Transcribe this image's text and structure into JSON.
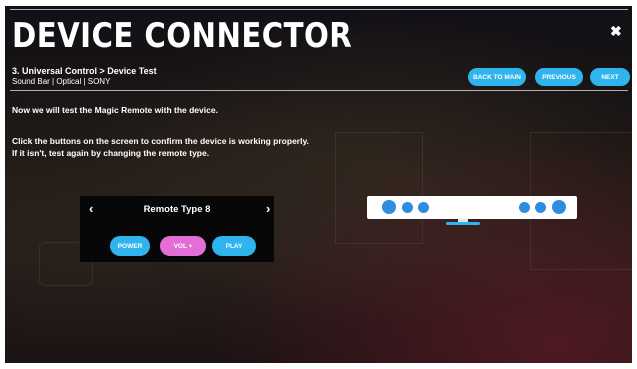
{
  "header": {
    "title": "DEVICE CONNECTOR",
    "close_glyph": "✖",
    "breadcrumb": "3. Universal Control > Device Test",
    "subtitle": "Sound Bar | Optical | SONY"
  },
  "nav_buttons": {
    "back": "BACK TO MAIN",
    "previous": "PREVIOUS",
    "next": "NEXT"
  },
  "instructions": {
    "line1": "Now we will test the Magic Remote with the device.",
    "line2": "Click the buttons on the screen to confirm the device is working properly.",
    "line3": "If it isn't, test again by changing the remote type."
  },
  "remote": {
    "prev_arrow": "‹",
    "type_label": "Remote Type 8",
    "next_arrow": "›"
  },
  "test_buttons": {
    "power": "POWER",
    "vol": "VOL +",
    "play": "PLAY"
  },
  "colors": {
    "accent_blue": "#2fb4ee",
    "accent_pink": "#e36fd6",
    "device_dot": "#2d8de0",
    "device_body": "#ffffff"
  },
  "icons": {
    "close": "close-icon",
    "arrow_left": "chevron-left-icon",
    "arrow_right": "chevron-right-icon",
    "device": "soundbar-icon"
  }
}
